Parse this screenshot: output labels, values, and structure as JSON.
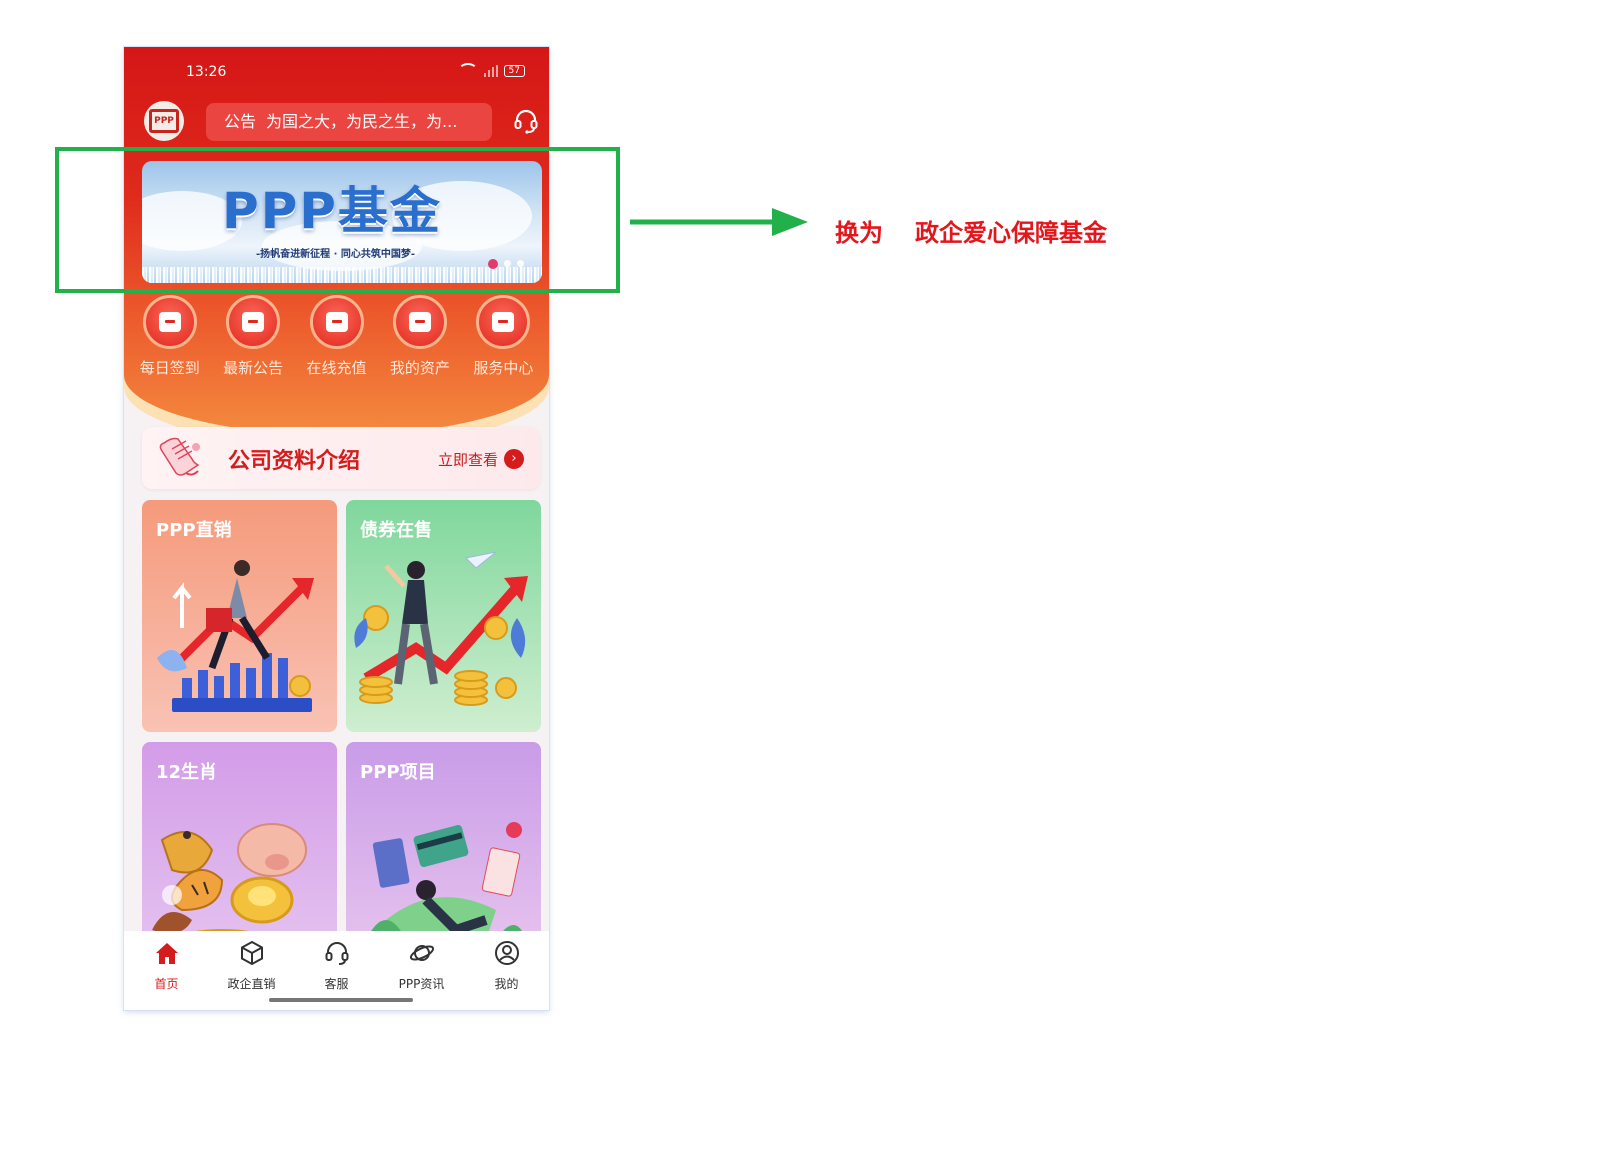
{
  "status_bar": {
    "time": "13:26",
    "battery": "57"
  },
  "header": {
    "notice_tag": "公告",
    "notice_text": "为国之大，为民之生，为...",
    "logo_text": "PPP"
  },
  "banner": {
    "title": "PPP基金",
    "subtitle": "-扬帆奋进新征程 · 同心共筑中国梦-",
    "slide_count": 3,
    "active_slide": 1
  },
  "quick_menu": [
    {
      "label": "每日签到",
      "icon": "calendar-check-icon"
    },
    {
      "label": "最新公告",
      "icon": "bag-notice-icon"
    },
    {
      "label": "在线充值",
      "icon": "wallet-icon"
    },
    {
      "label": "我的资产",
      "icon": "coin-stack-icon"
    },
    {
      "label": "服务中心",
      "icon": "service-person-icon"
    }
  ],
  "company": {
    "title": "公司资料介绍",
    "more": "立即查看"
  },
  "cards": [
    {
      "title": "PPP直销"
    },
    {
      "title": "债券在售"
    },
    {
      "title": "12生肖"
    },
    {
      "title": "PPP项目"
    }
  ],
  "tabbar": [
    {
      "label": "首页",
      "icon": "home-icon",
      "active": true
    },
    {
      "label": "政企直销",
      "icon": "cube-icon",
      "active": false
    },
    {
      "label": "客服",
      "icon": "headset-icon",
      "active": false
    },
    {
      "label": "PPP资讯",
      "icon": "planet-icon",
      "active": false
    },
    {
      "label": "我的",
      "icon": "user-circle-icon",
      "active": false
    }
  ],
  "annotation": {
    "prefix": "换为",
    "text": "政企爱心保障基金"
  },
  "colors": {
    "primary_red": "#d51616",
    "annotation_green": "#22b04a",
    "annotation_red": "#e3161c"
  }
}
